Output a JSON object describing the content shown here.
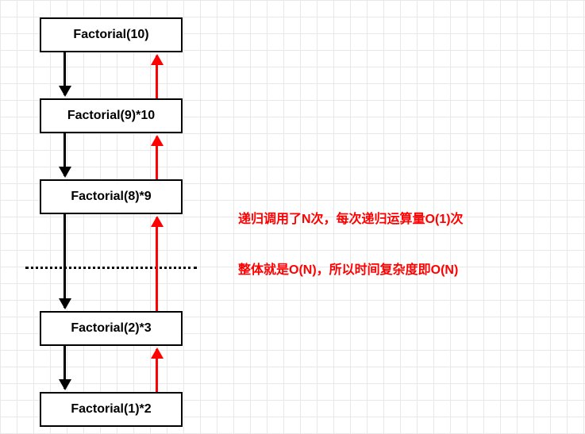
{
  "nodes": [
    {
      "label": "Factorial(10)"
    },
    {
      "label": "Factorial(9)*10"
    },
    {
      "label": "Factorial(8)*9"
    },
    {
      "label": "Factorial(2)*3"
    },
    {
      "label": "Factorial(1)*2"
    }
  ],
  "annotations": {
    "line1": "递归调用了N次，每次递归运算量O(1)次",
    "line2": "整体就是O(N)，所以时间复杂度即O(N)"
  },
  "chart_data": {
    "type": "diagram",
    "title": "Factorial Recursion Call Stack",
    "nodes": [
      "Factorial(10)",
      "Factorial(9)*10",
      "Factorial(8)*9",
      "Factorial(2)*3",
      "Factorial(1)*2"
    ],
    "edges_down": [
      {
        "from": "Factorial(10)",
        "to": "Factorial(9)*10"
      },
      {
        "from": "Factorial(9)*10",
        "to": "Factorial(8)*9"
      },
      {
        "from": "Factorial(8)*9",
        "to": "..."
      },
      {
        "from": "...",
        "to": "Factorial(2)*3"
      },
      {
        "from": "Factorial(2)*3",
        "to": "Factorial(1)*2"
      }
    ],
    "edges_up": [
      {
        "from": "Factorial(1)*2",
        "to": "Factorial(2)*3"
      },
      {
        "from": "Factorial(2)*3",
        "to": "..."
      },
      {
        "from": "...",
        "to": "Factorial(8)*9"
      },
      {
        "from": "Factorial(8)*9",
        "to": "Factorial(9)*10"
      },
      {
        "from": "Factorial(9)*10",
        "to": "Factorial(10)"
      }
    ],
    "annotations": [
      "递归调用了N次，每次递归运算量O(1)次",
      "整体就是O(N)，所以时间复杂度即O(N)"
    ],
    "arrow_colors": {
      "down": "#000000",
      "up": "#ff0000"
    }
  }
}
